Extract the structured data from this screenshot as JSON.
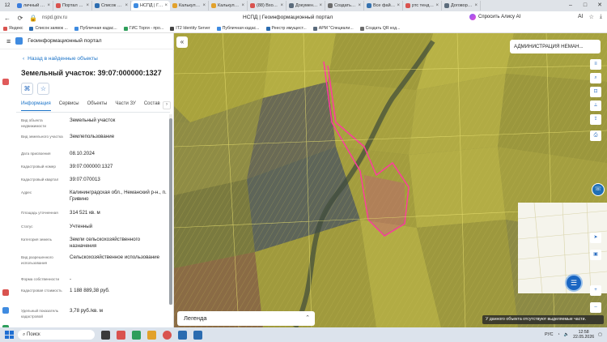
{
  "browser": {
    "tab_count": "12",
    "tabs": [
      {
        "label": "личный кабі",
        "color": "#3b7ddd"
      },
      {
        "label": "Портал госуд",
        "color": "#d9534f"
      },
      {
        "label": "Список заявок",
        "color": "#2b6cb0"
      },
      {
        "label": "НСПД | Гео",
        "color": "#3f8be0",
        "active": true
      },
      {
        "label": "Калькулятор",
        "color": "#e2a12b"
      },
      {
        "label": "Калькулятор",
        "color": "#e2a12b"
      },
      {
        "label": "(88) Входящ",
        "color": "#d9534f"
      },
      {
        "label": "Документы",
        "color": "#5b6b7b"
      },
      {
        "label": "Создать QR",
        "color": "#6c6c6c"
      },
      {
        "label": "Все файлы",
        "color": "#3572b0"
      },
      {
        "label": "ртс тендер",
        "color": "#d9534f"
      },
      {
        "label": "Договор №",
        "color": "#5b6b7b"
      }
    ],
    "url": "nspd.gov.ru",
    "page_title": "НСПД | Геоинформационный портал",
    "alice_label": "Спросить Алису AI",
    "bookmarks": [
      {
        "label": "Яндекс",
        "color": "#d9534f"
      },
      {
        "label": "Список заявок ...",
        "color": "#2b6cb0"
      },
      {
        "label": "Публичная кадас...",
        "color": "#3f8be0"
      },
      {
        "label": "ГИС Торги - про...",
        "color": "#2e9e5b"
      },
      {
        "label": "IT2 Identity Server",
        "color": "#444444"
      },
      {
        "label": "Публичная кадас...",
        "color": "#3f8be0"
      },
      {
        "label": "Реестр имущест...",
        "color": "#2b6cb0"
      },
      {
        "label": "АРМ \"Специали...",
        "color": "#5b6b7b"
      },
      {
        "label": "Создать QR код...",
        "color": "#6c6c6c"
      }
    ]
  },
  "portal": {
    "title": "Геоинформационный портал",
    "back_label": "Назад в найденные объекты",
    "parcel_title": "Земельный участок: 39:07:000000:1327",
    "tabs": [
      "Информация",
      "Сервисы",
      "Объекты",
      "Части ЗУ",
      "Состав"
    ],
    "active_tab": 0,
    "properties": [
      {
        "key": "Вид объекта недвижимости",
        "value": "Земельный участок"
      },
      {
        "key": "Вид земельного участка",
        "value": "Землепользование"
      },
      {
        "key": "Дата присвоения",
        "value": "08.10.2024"
      },
      {
        "key": "Кадастровый номер",
        "value": "39:07:000000:1327"
      },
      {
        "key": "Кадастровый квартал",
        "value": "39:07:070013"
      },
      {
        "key": "Адрес",
        "value": "Калининградская обл., Неманский р-н., п. Гривино"
      },
      {
        "key": "Площадь уточненная",
        "value": "314 521 кв. м"
      },
      {
        "key": "Статус",
        "value": "Учтенный"
      },
      {
        "key": "Категория земель",
        "value": "Земли сельскохозяйственного назначения"
      },
      {
        "key": "Вид разрешенного использования",
        "value": "Сельскохозяйственное использование"
      },
      {
        "key": "Форма собственности",
        "value": "-"
      },
      {
        "key": "Кадастровая стоимость",
        "value": "1 188 889,38 руб."
      },
      {
        "key": "Удельный показатель кадастровой",
        "value": "3,78 руб./кв. м"
      }
    ]
  },
  "map": {
    "admin_select": "АДМИНИСТРАЦИЯ НЕМАН...",
    "legend_label": "Легенда",
    "no_selection_msg": "У данного объекта отсутствуют выделяемые части."
  },
  "taskbar": {
    "search_label": "Поиск",
    "lang": "РУС",
    "time": "12:58",
    "date": "22.05.2026"
  },
  "colors": {
    "accent": "#1a73c8",
    "parcel_outline": "#ff3aa0",
    "field_fill": "#b8b035"
  }
}
